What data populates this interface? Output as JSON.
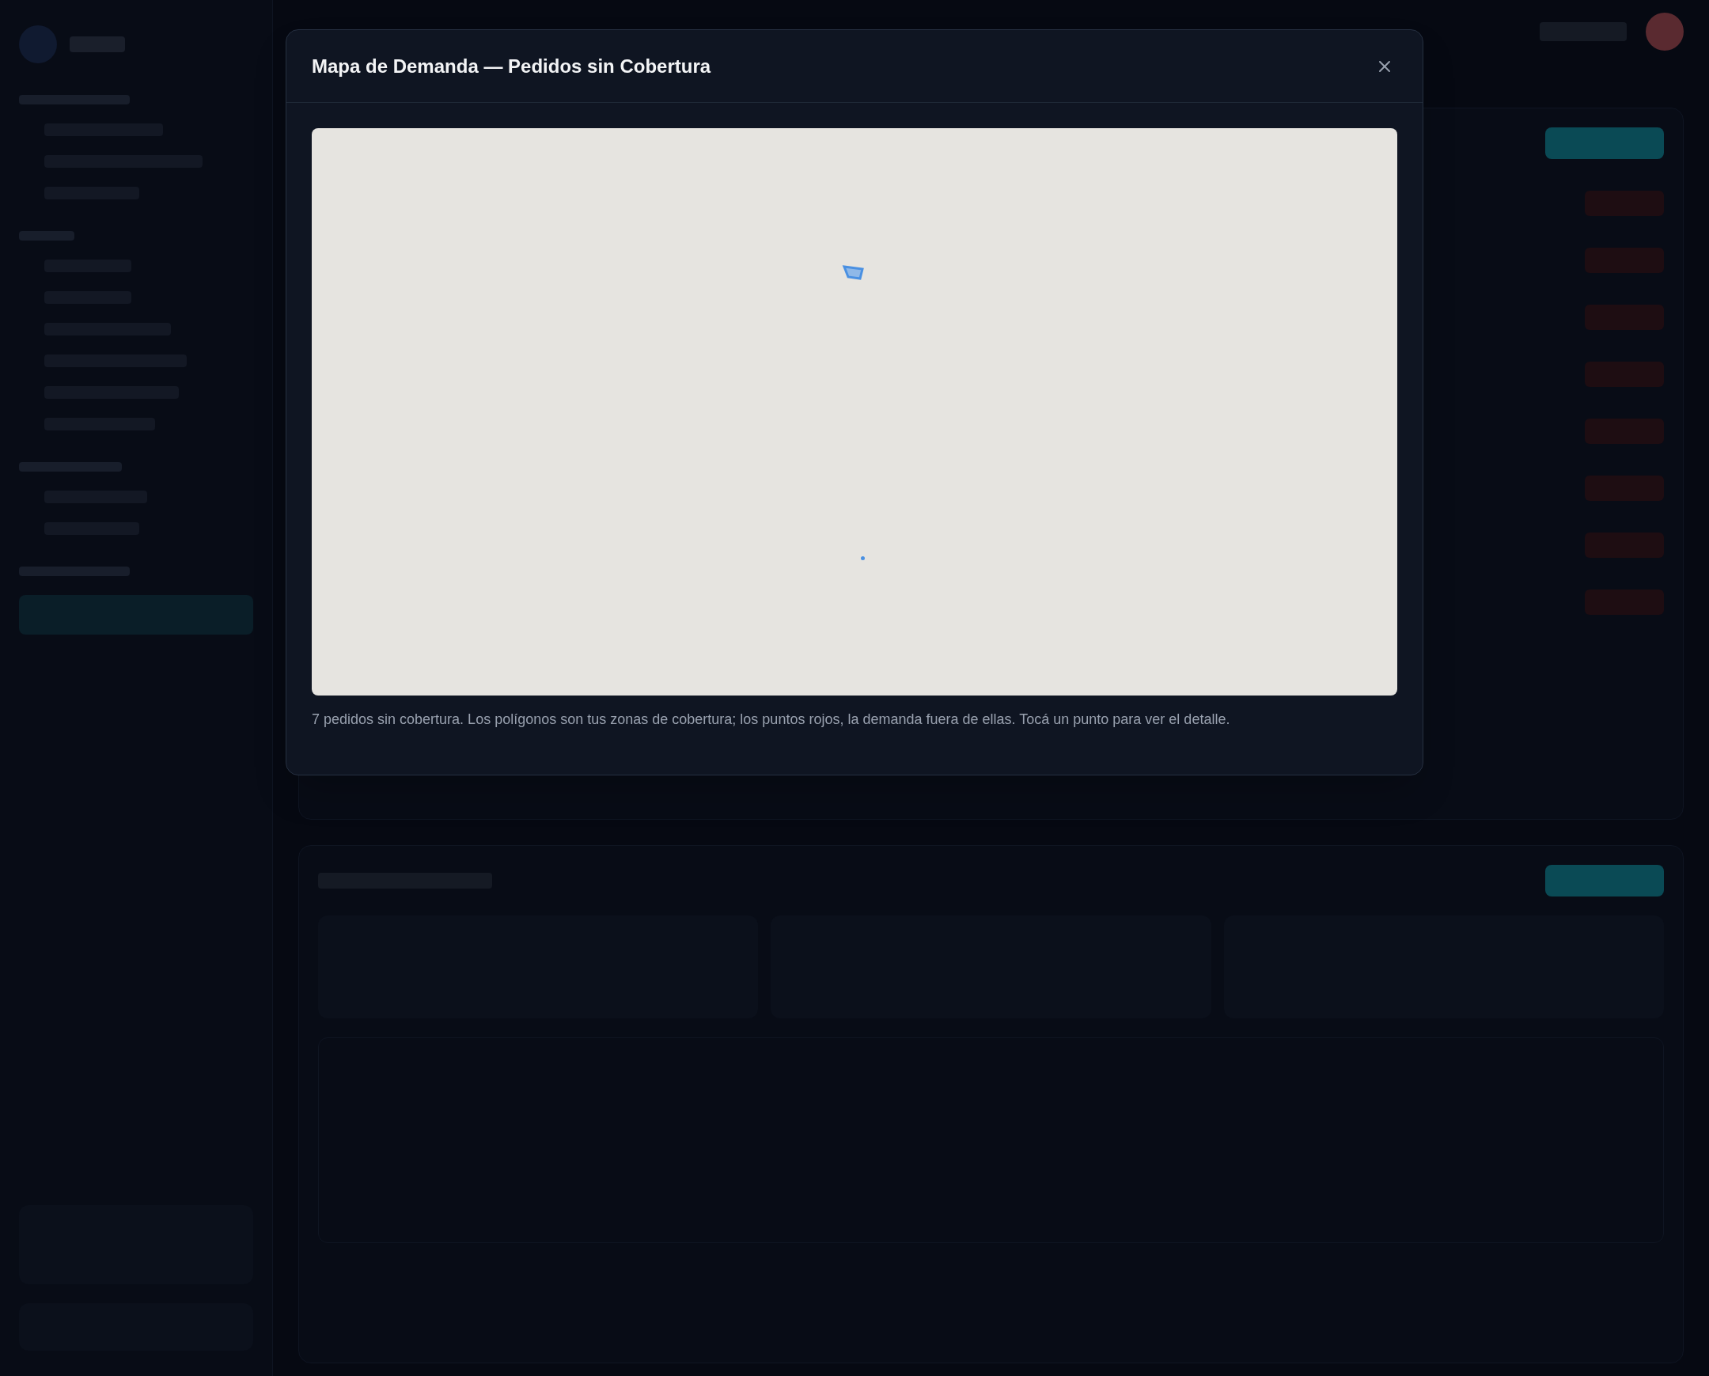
{
  "modal": {
    "title": "Mapa de Demanda — Pedidos sin Cobertura",
    "caption": "7 pedidos sin cobertura. Los polígonos son tus zonas de cobertura; los puntos rojos, la demanda fuera de ellas. Tocá un punto para ver el detalle."
  }
}
